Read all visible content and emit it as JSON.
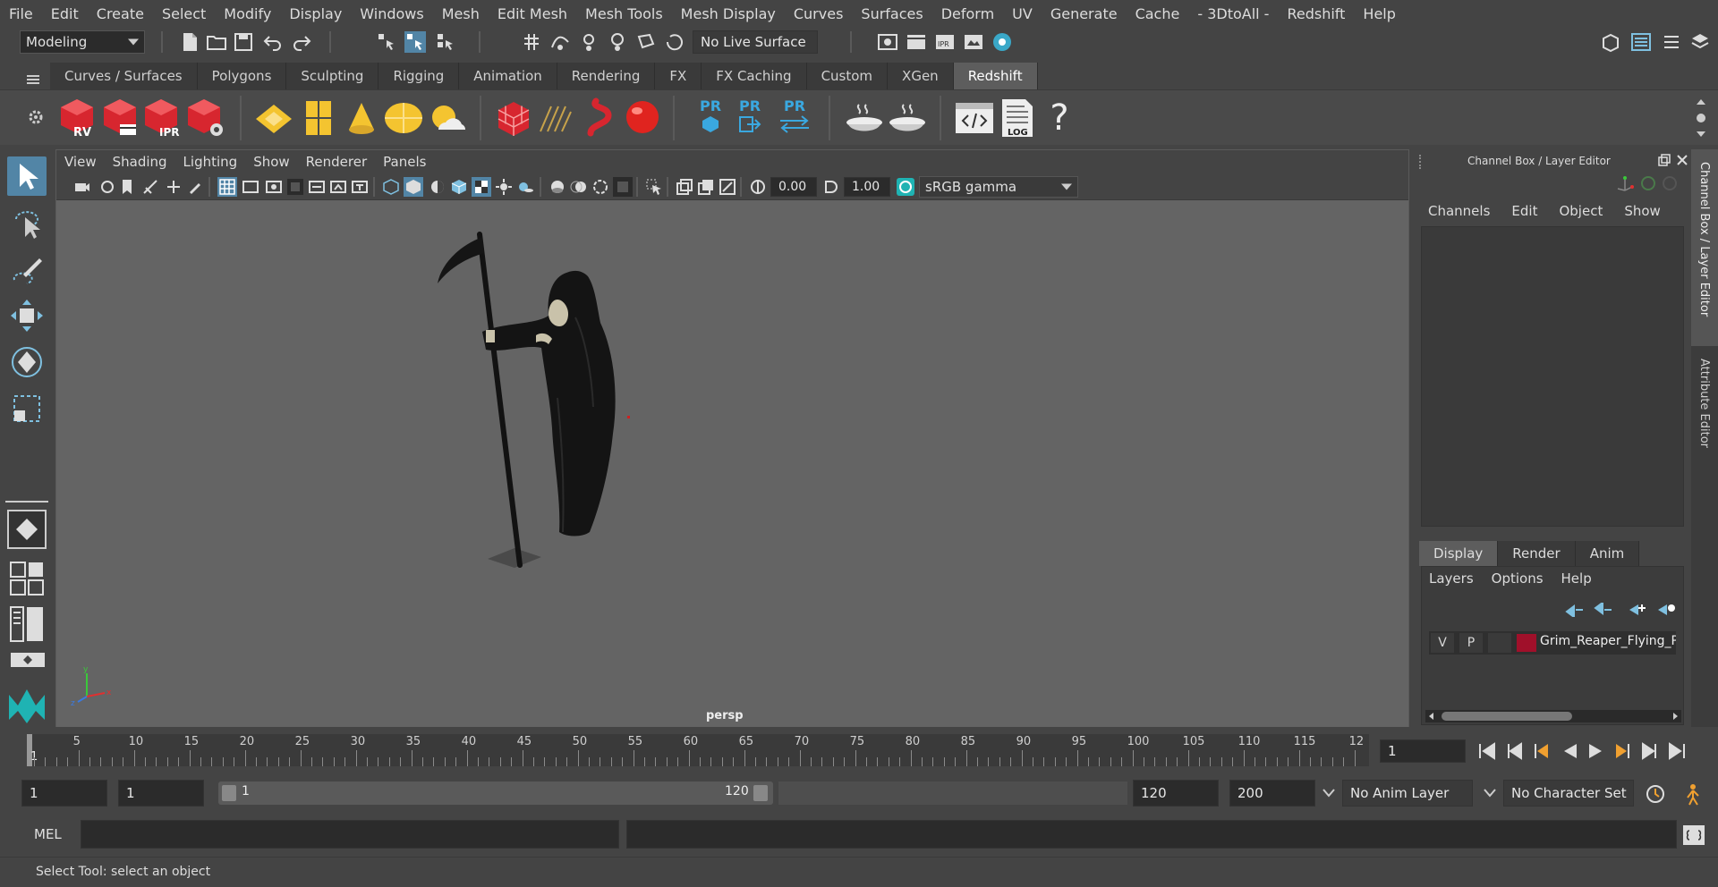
{
  "menus": [
    "File",
    "Edit",
    "Create",
    "Select",
    "Modify",
    "Display",
    "Windows",
    "Mesh",
    "Edit Mesh",
    "Mesh Tools",
    "Mesh Display",
    "Curves",
    "Surfaces",
    "Deform",
    "UV",
    "Generate",
    "Cache",
    "- 3DtoAll -",
    "Redshift",
    "Help"
  ],
  "toolbar": {
    "workspace": "Modeling",
    "live_surface": "No Live Surface"
  },
  "shelf_tabs": [
    "Curves / Surfaces",
    "Polygons",
    "Sculpting",
    "Rigging",
    "Animation",
    "Rendering",
    "FX",
    "FX Caching",
    "Custom",
    "XGen",
    "Redshift"
  ],
  "shelf_active": "Redshift",
  "shelf_icons": {
    "rv": "RV",
    "ipr": "IPR",
    "pr": "PR",
    "log": "LOG",
    "help": "?"
  },
  "viewport": {
    "menus": [
      "View",
      "Shading",
      "Lighting",
      "Show",
      "Renderer",
      "Panels"
    ],
    "exposure": "0.00",
    "gamma": "1.00",
    "color_space": "sRGB gamma",
    "camera_label": "persp",
    "axis_x": "x",
    "axis_y": "y",
    "axis_z": "z"
  },
  "channel_box": {
    "title": "Channel Box / Layer Editor",
    "menus": [
      "Channels",
      "Edit",
      "Object",
      "Show"
    ]
  },
  "layer_editor": {
    "tabs": [
      "Display",
      "Render",
      "Anim"
    ],
    "active_tab": "Display",
    "menus": [
      "Layers",
      "Options",
      "Help"
    ],
    "layer": {
      "v": "V",
      "p": "P",
      "name": "Grim_Reaper_Flying_Po",
      "color": "#a0102a"
    }
  },
  "side_tabs": [
    "Channel Box / Layer Editor",
    "Attribute Editor"
  ],
  "timeline": {
    "ticks": [
      "5",
      "10",
      "15",
      "20",
      "25",
      "30",
      "35",
      "40",
      "45",
      "50",
      "55",
      "60",
      "65",
      "70",
      "75",
      "80",
      "85",
      "90",
      "95",
      "100",
      "105",
      "110",
      "115",
      "12"
    ],
    "current_marker": "1",
    "current_frame": "1"
  },
  "range": {
    "start": "1",
    "playback_start": "1",
    "slider_start": "1",
    "slider_end": "120",
    "playback_end": "120",
    "end": "200",
    "anim_layer": "No Anim Layer",
    "character_set": "No Character Set"
  },
  "mel": {
    "label": "MEL"
  },
  "status": {
    "text": "Select Tool: select an object"
  },
  "colors": {
    "accent": "#5285a6",
    "redshift_red": "#c8202c",
    "tool_yellow": "#f4c430"
  }
}
